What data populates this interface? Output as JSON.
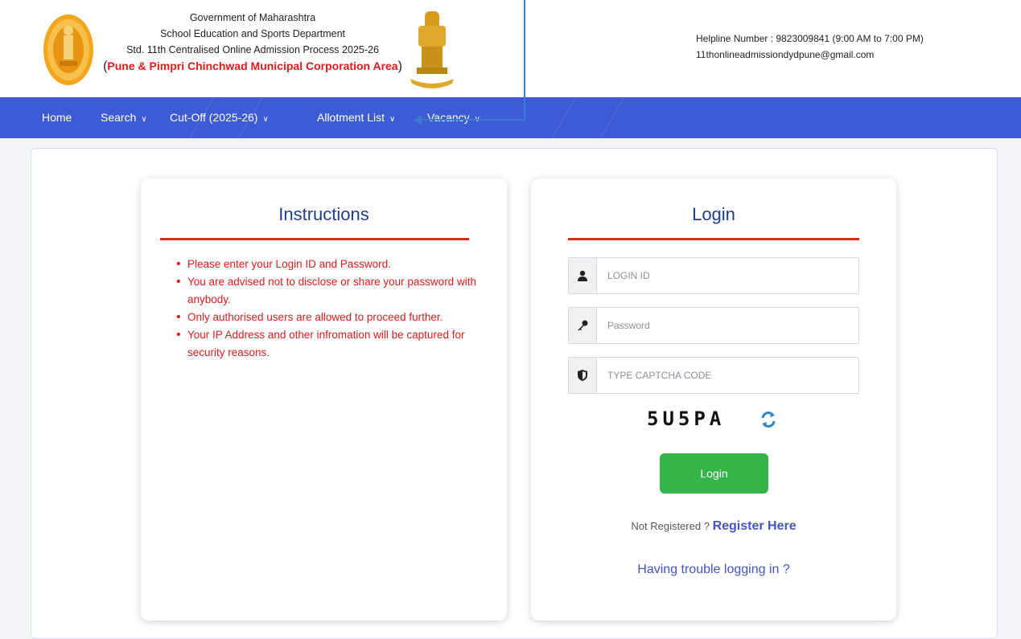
{
  "header": {
    "line1": "Government of Maharashtra",
    "line2": "School Education and Sports Department",
    "line3": "Std. 11th Centralised Online Admission Process 2025-26",
    "line4_open": "(",
    "line4_text": "Pune & Pimpri Chinchwad Municipal Corporation Area",
    "line4_close": ")",
    "helpline": "Helpline Number : 9823009841 (9:00 AM to 7:00 PM)",
    "email": "11thonlineadmissiondydpune@gmail.com"
  },
  "nav": {
    "items": [
      {
        "label": "Home",
        "has_dropdown": false
      },
      {
        "label": "Search",
        "has_dropdown": true
      },
      {
        "label": "Cut-Off (2025-26)",
        "has_dropdown": true
      },
      {
        "label": "Allotment List",
        "has_dropdown": true
      },
      {
        "label": "Vacancy",
        "has_dropdown": true
      }
    ],
    "chevron": "∨"
  },
  "instructions": {
    "title": "Instructions",
    "items": [
      "Please enter your Login ID and Password.",
      "You are advised not to disclose or share your password with anybody.",
      "Only authorised users are allowed to proceed further.",
      "Your IP Address and other infromation will be captured for security reasons."
    ]
  },
  "login": {
    "title": "Login",
    "login_id_placeholder": "LOGIN ID",
    "password_placeholder": "Password",
    "captcha_placeholder": "TYPE CAPTCHA CODE",
    "captcha_text": "5U5PA",
    "button": "Login",
    "not_registered": "Not Registered ? ",
    "register_link": "Register Here",
    "trouble_link": "Having trouble logging in ?"
  },
  "colors": {
    "nav_bg": "#3e5bd6",
    "accent_red": "#e11b1b",
    "title_blue": "#1f3d8c",
    "link_blue": "#4453c7",
    "button_green": "#35b44a"
  },
  "icons": {
    "left_logo": "maharashtra-seal-icon",
    "right_logo": "national-emblem-icon",
    "user": "user-icon",
    "key": "key-icon",
    "shield": "shield-icon",
    "refresh": "refresh-icon",
    "chevron": "chevron-down-icon",
    "pointer": "annotation-arrow-icon"
  }
}
